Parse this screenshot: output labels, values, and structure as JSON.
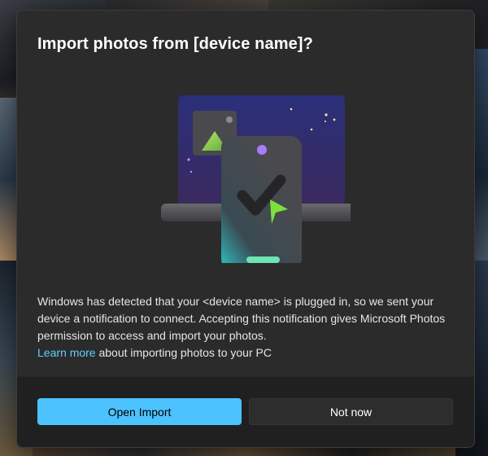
{
  "dialog": {
    "title": "Import photos from [device name]?",
    "body": "Windows has detected that your <device name> is plugged in, so we sent your device a notification to connect. Accepting this notification gives Microsoft Photos permission to access and import your photos.",
    "learn_more_link": "Learn more",
    "learn_more_suffix": " about importing photos to your PC",
    "illustration": "phone-connected-to-laptop-illustration"
  },
  "buttons": {
    "primary_label": "Open Import",
    "secondary_label": "Not now"
  },
  "colors": {
    "accent": "#4cc2ff",
    "link": "#60cdff",
    "dialog_bg": "#2b2b2b",
    "footer_bg": "#202020"
  }
}
